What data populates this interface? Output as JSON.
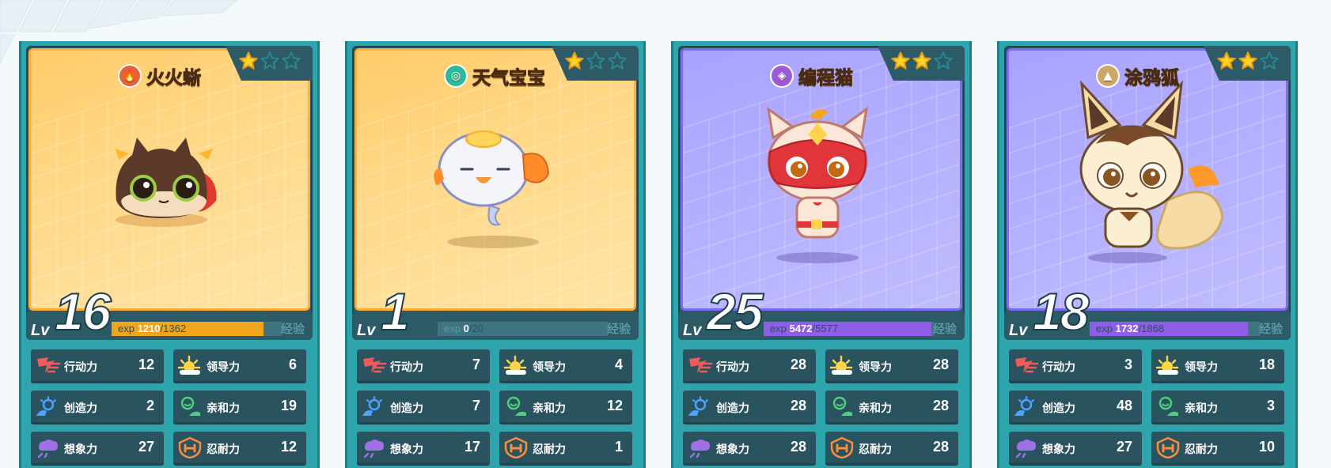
{
  "cards": [
    {
      "name": "火火蜥",
      "element": "fire",
      "element_glyph": "🔥",
      "element_color": "#e8603a",
      "stars": 1,
      "theme": "orange",
      "lv_label": "Lv",
      "level": "16",
      "exp_prefix": "exp",
      "exp_current": "1210",
      "exp_max": "/1362",
      "exp_fraction": 0.888,
      "exp_color": "#f2a51a",
      "exp_label": "经验",
      "stats": [
        {
          "name": "行动力",
          "value": "12",
          "icon": "action-icon"
        },
        {
          "name": "领导力",
          "value": "6",
          "icon": "leadership-icon"
        },
        {
          "name": "创造力",
          "value": "2",
          "icon": "creativity-icon"
        },
        {
          "name": "亲和力",
          "value": "19",
          "icon": "affinity-icon"
        },
        {
          "name": "想象力",
          "value": "27",
          "icon": "imagination-icon"
        },
        {
          "name": "忍耐力",
          "value": "12",
          "icon": "endurance-icon"
        }
      ]
    },
    {
      "name": "天气宝宝",
      "element": "weather",
      "element_glyph": "◎",
      "element_color": "#2fb89a",
      "stars": 1,
      "theme": "orange",
      "lv_label": "Lv",
      "level": "1",
      "exp_prefix": "exp",
      "exp_current": "0",
      "exp_max": "/20",
      "exp_fraction": 0,
      "exp_color": "#f2a51a",
      "exp_label": "经验",
      "stats": [
        {
          "name": "行动力",
          "value": "7",
          "icon": "action-icon"
        },
        {
          "name": "领导力",
          "value": "4",
          "icon": "leadership-icon"
        },
        {
          "name": "创造力",
          "value": "7",
          "icon": "creativity-icon"
        },
        {
          "name": "亲和力",
          "value": "12",
          "icon": "affinity-icon"
        },
        {
          "name": "想象力",
          "value": "17",
          "icon": "imagination-icon"
        },
        {
          "name": "忍耐力",
          "value": "1",
          "icon": "endurance-icon"
        }
      ]
    },
    {
      "name": "编程猫",
      "element": "code",
      "element_glyph": "◈",
      "element_color": "#9b5ad8",
      "stars": 2,
      "theme": "purple",
      "lv_label": "Lv",
      "level": "25",
      "exp_prefix": "exp",
      "exp_current": "5472",
      "exp_max": "/5577",
      "exp_fraction": 0.981,
      "exp_color": "#8e5fe6",
      "exp_label": "经验",
      "stats": [
        {
          "name": "行动力",
          "value": "28",
          "icon": "action-icon"
        },
        {
          "name": "领导力",
          "value": "28",
          "icon": "leadership-icon"
        },
        {
          "name": "创造力",
          "value": "28",
          "icon": "creativity-icon"
        },
        {
          "name": "亲和力",
          "value": "28",
          "icon": "affinity-icon"
        },
        {
          "name": "想象力",
          "value": "28",
          "icon": "imagination-icon"
        },
        {
          "name": "忍耐力",
          "value": "28",
          "icon": "endurance-icon"
        }
      ]
    },
    {
      "name": "涂鸦狐",
      "element": "art",
      "element_glyph": "▲",
      "element_color": "#c9a86a",
      "stars": 2,
      "theme": "purple",
      "lv_label": "Lv",
      "level": "18",
      "exp_prefix": "exp",
      "exp_current": "1732",
      "exp_max": "/1868",
      "exp_fraction": 0.927,
      "exp_color": "#8e5fe6",
      "exp_label": "经验",
      "stats": [
        {
          "name": "行动力",
          "value": "3",
          "icon": "action-icon"
        },
        {
          "name": "领导力",
          "value": "18",
          "icon": "leadership-icon"
        },
        {
          "name": "创造力",
          "value": "48",
          "icon": "creativity-icon"
        },
        {
          "name": "亲和力",
          "value": "3",
          "icon": "affinity-icon"
        },
        {
          "name": "想象力",
          "value": "27",
          "icon": "imagination-icon"
        },
        {
          "name": "忍耐力",
          "value": "10",
          "icon": "endurance-icon"
        }
      ]
    }
  ]
}
